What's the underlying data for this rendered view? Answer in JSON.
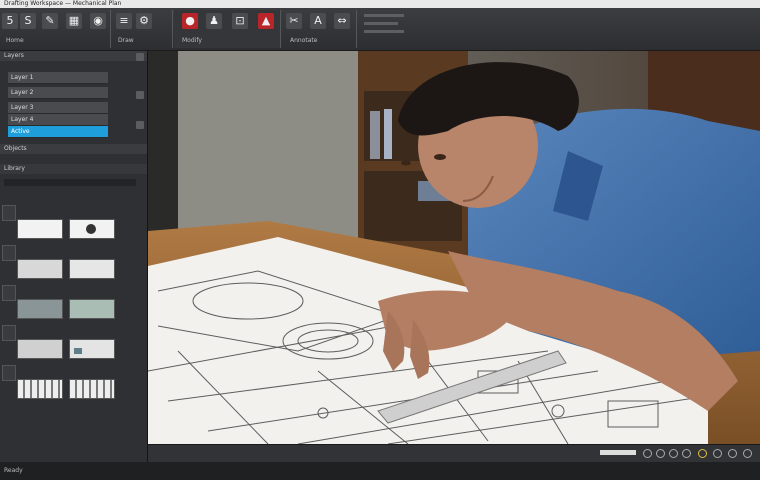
{
  "window": {
    "title": "Drafting Workspace — Mechanical Plan"
  },
  "ribbon": {
    "groups": [
      {
        "label": "Home"
      },
      {
        "label": "Draw"
      },
      {
        "label": "Modify"
      },
      {
        "label": "Annotate"
      }
    ],
    "buttons": [
      {
        "icon": "new-file-icon",
        "glyph": "5"
      },
      {
        "icon": "save-icon",
        "glyph": "S"
      },
      {
        "icon": "pen-icon",
        "glyph": "✎"
      },
      {
        "icon": "grid-icon",
        "glyph": "▦"
      },
      {
        "icon": "camera-icon",
        "glyph": "◉"
      },
      {
        "icon": "layers-icon",
        "glyph": "≡"
      },
      {
        "icon": "settings-icon",
        "glyph": "⚙"
      },
      {
        "icon": "record-icon",
        "glyph": "●"
      },
      {
        "icon": "user-icon",
        "glyph": "♟"
      },
      {
        "icon": "lock-icon",
        "glyph": "⊡"
      },
      {
        "icon": "alert-icon",
        "glyph": "▲"
      },
      {
        "icon": "tools-icon",
        "glyph": "✂"
      },
      {
        "icon": "text-icon",
        "glyph": "A"
      },
      {
        "icon": "measure-icon",
        "glyph": "⇔"
      }
    ]
  },
  "left_panel": {
    "header": "Layers",
    "rows": [
      {
        "label": "Layer 1"
      },
      {
        "label": "Layer 2"
      },
      {
        "label": "Layer 3"
      },
      {
        "label": "Layer 4"
      },
      {
        "label": "Active",
        "selected": true
      }
    ],
    "section_header": "Objects",
    "sub_header": "Library"
  },
  "status": {
    "text": "Ready"
  },
  "colors": {
    "accent": "#1e9fdc",
    "ribbon": "#2d2e31",
    "alert": "#b8262a"
  }
}
